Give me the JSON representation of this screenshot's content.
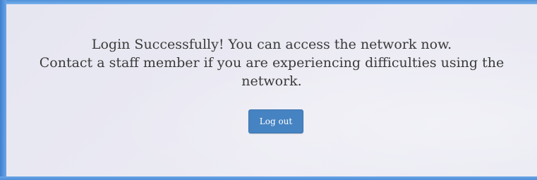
{
  "message": {
    "line1": "Login Successfully! You can access the network now.",
    "line2": "Contact a staff member if you are experiencing difficulties using the",
    "line3": "network."
  },
  "logout_button": {
    "label": "Log out"
  },
  "colors": {
    "frame": "#5f9fe0",
    "panel_background": "#e8e8f2",
    "button_background": "#4683c2",
    "text": "#3a3a3a"
  }
}
